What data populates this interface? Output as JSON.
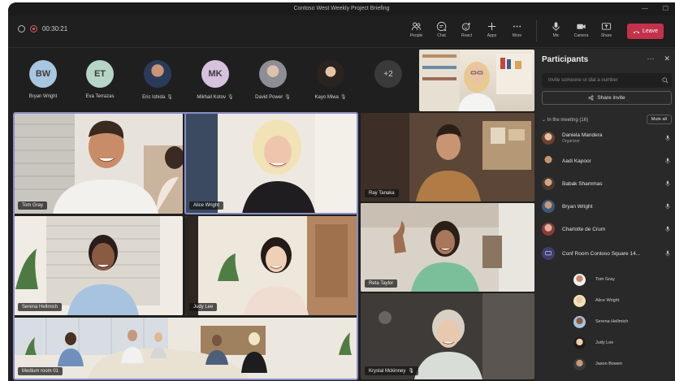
{
  "window": {
    "title": "Contoso West Weekly Project Briefing"
  },
  "toolbar": {
    "timer": "00:30:21",
    "buttons": [
      {
        "label": "People",
        "icon": "people-icon"
      },
      {
        "label": "Chat",
        "icon": "chat-icon"
      },
      {
        "label": "React",
        "icon": "react-icon"
      },
      {
        "label": "Apps",
        "icon": "apps-icon"
      },
      {
        "label": "More",
        "icon": "more-icon"
      },
      {
        "label": "Mic",
        "icon": "mic-icon"
      },
      {
        "label": "Camera",
        "icon": "camera-icon"
      },
      {
        "label": "Share",
        "icon": "share-icon"
      }
    ],
    "leave_label": "Leave",
    "colors": {
      "leave": "#c4314b",
      "background": "#1f1f1f",
      "accent": "#8b8cc7"
    }
  },
  "avatar_row": {
    "people": [
      {
        "initials": "BW",
        "name": "Bryan Wright",
        "muted": false
      },
      {
        "initials": "ET",
        "name": "Eva Terrazas",
        "muted": false
      },
      {
        "initials": "",
        "name": "Eric Ishida",
        "muted": true
      },
      {
        "initials": "MK",
        "name": "Mikhail Kotov",
        "muted": true
      },
      {
        "initials": "",
        "name": "David Power",
        "muted": true
      },
      {
        "initials": "",
        "name": "Kayo Miwa",
        "muted": true
      }
    ],
    "overflow": "+2"
  },
  "tiles": {
    "tom": {
      "name": "Tom Gray"
    },
    "alice": {
      "name": "Alice Wright"
    },
    "serena": {
      "name": "Serena Hellmich"
    },
    "judy": {
      "name": "Judy Lee"
    },
    "medium": {
      "name": "Medium room 01"
    },
    "ray": {
      "name": "Ray Tanaka"
    },
    "reta": {
      "name": "Reta Taylor"
    },
    "krystal": {
      "name": "Krystal Mckinney"
    }
  },
  "panel": {
    "title": "Participants",
    "search_placeholder": "Invite someone or dial a number",
    "share_invite": "Share invite",
    "section_label": "In the meeting (16)",
    "mute_all": "Mute all",
    "participants": [
      {
        "name": "Daniela Mandera",
        "role": "Organizer"
      },
      {
        "name": "Aadi Kapoor",
        "role": ""
      },
      {
        "name": "Babak Shammas",
        "role": ""
      },
      {
        "name": "Bryan Wright",
        "role": ""
      },
      {
        "name": "Charlotte de Crum",
        "role": ""
      },
      {
        "name": "Conf Room Contoso Square 14...",
        "role": ""
      }
    ],
    "room_members": [
      "Tom Gray",
      "Alice Wright",
      "Serena Hellmich",
      "Judy Lee",
      "Jason Bowen"
    ]
  }
}
